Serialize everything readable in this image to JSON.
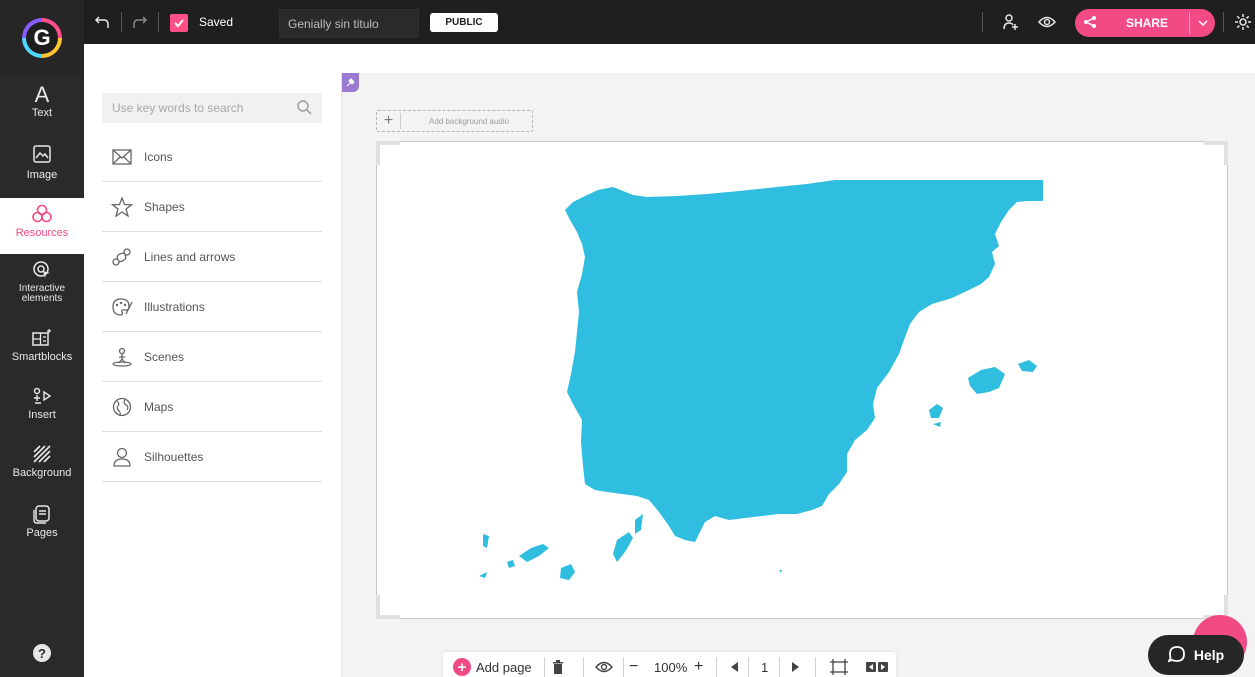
{
  "topbar": {
    "saved_label": "Saved",
    "title_value": "Genially sin titulo",
    "public_label": "PUBLIC",
    "share_label": "SHARE"
  },
  "sidebar": {
    "items": [
      {
        "id": "text",
        "label": "Text"
      },
      {
        "id": "image",
        "label": "Image"
      },
      {
        "id": "resources",
        "label": "Resources"
      },
      {
        "id": "interactive",
        "label": "Interactive\nelements"
      },
      {
        "id": "smartblocks",
        "label": "Smartblocks"
      },
      {
        "id": "insert",
        "label": "Insert"
      },
      {
        "id": "background",
        "label": "Background"
      },
      {
        "id": "pages",
        "label": "Pages"
      }
    ],
    "help_glyph": "?"
  },
  "panel": {
    "search_placeholder": "Use key words to search",
    "items": [
      {
        "label": "Icons"
      },
      {
        "label": "Shapes"
      },
      {
        "label": "Lines and arrows"
      },
      {
        "label": "Illustrations"
      },
      {
        "label": "Scenes"
      },
      {
        "label": "Maps"
      },
      {
        "label": "Silhouettes"
      }
    ]
  },
  "canvas": {
    "audio_label": "Add background audio",
    "map_color": "#2fbde0"
  },
  "bottom": {
    "add_page_label": "Add page",
    "zoom_value": "100%",
    "page_number": "1"
  },
  "help": {
    "label": "Help"
  },
  "colors": {
    "accent": "#f24a85",
    "dark_bar": "#1f1f1f",
    "sidebar": "#2a2a2a"
  }
}
